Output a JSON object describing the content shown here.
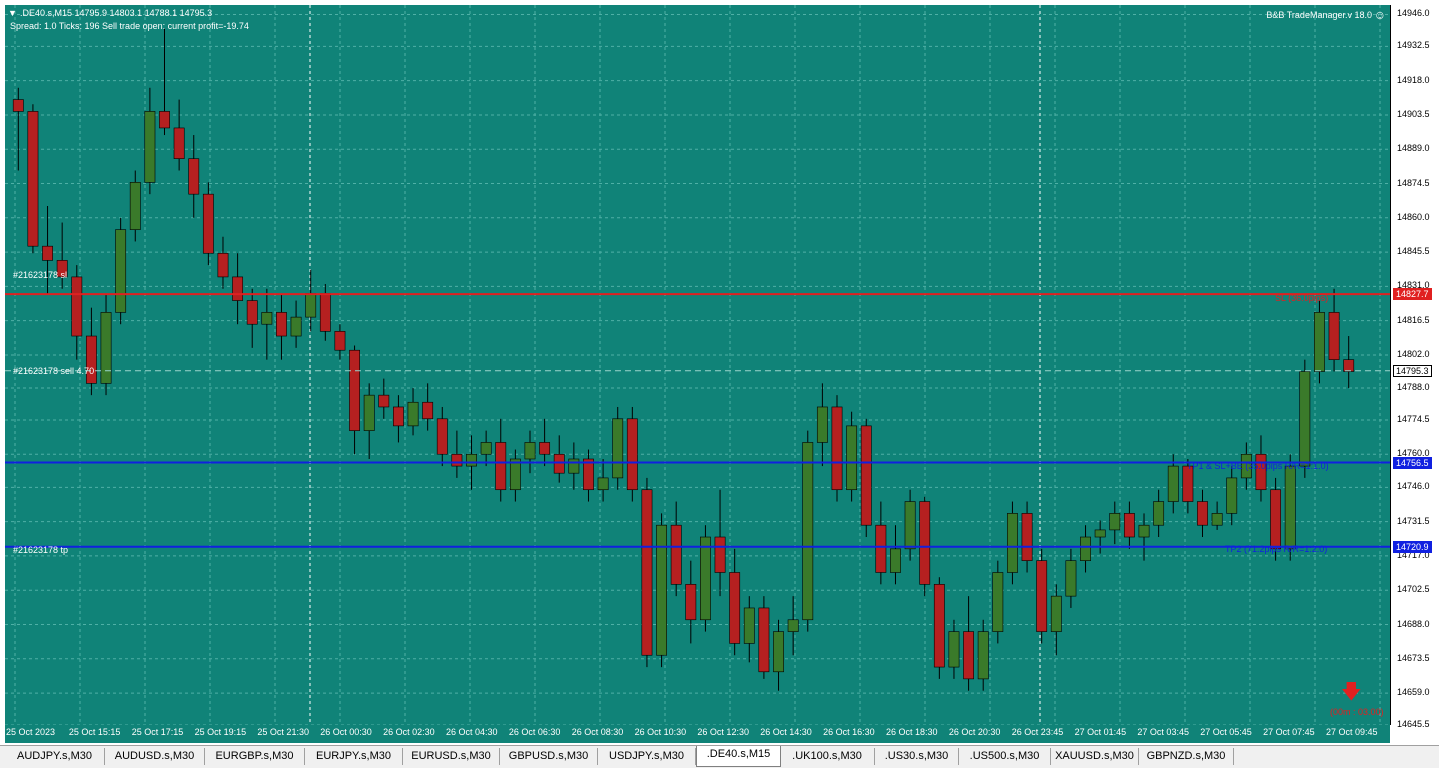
{
  "header": {
    "symbol_line": ".DE40.s,M15  14795.9 14803.1 14788.1 14795.3",
    "info_line": "Spread: 1.0  Ticks: 196  Sell trade open: current profit=-19.74",
    "manager": "B&B TradeManager.v 18.0",
    "smiley": "☺"
  },
  "order_labels": {
    "sl": "#21623178 sl",
    "sell": "#21623178 sell 4.70",
    "tp": "#21623178 tp"
  },
  "lines": {
    "sl_text": "SL (36.0pips)",
    "tp1_text": "TP1 & SL+BE (35.0pips R/R=1:1.0)",
    "tp2_text": "TP2 (71.2pips R/R=1:2.0)",
    "timer_text": "(00m : 03.00)"
  },
  "price_axis": {
    "ticks": [
      "14946.0",
      "14932.5",
      "14918.0",
      "14903.5",
      "14889.0",
      "14874.5",
      "14860.0",
      "14845.5",
      "14831.0",
      "14816.5",
      "14802.0",
      "14788.0",
      "14774.5",
      "14760.0",
      "14746.0",
      "14731.5",
      "14717.0",
      "14702.5",
      "14688.0",
      "14673.5",
      "14659.0",
      "14645.5"
    ],
    "sl_box": "14827.7",
    "current_box": "14795.3",
    "tp1_box": "14756.5",
    "tp2_box": "14720.9"
  },
  "time_axis": [
    "25 Oct 2023",
    "25 Oct 15:15",
    "25 Oct 17:15",
    "25 Oct 19:15",
    "25 Oct 21:30",
    "26 Oct 00:30",
    "26 Oct 02:30",
    "26 Oct 04:30",
    "26 Oct 06:30",
    "26 Oct 08:30",
    "26 Oct 10:30",
    "26 Oct 12:30",
    "26 Oct 14:30",
    "26 Oct 16:30",
    "26 Oct 18:30",
    "26 Oct 20:30",
    "26 Oct 23:45",
    "27 Oct 01:45",
    "27 Oct 03:45",
    "27 Oct 05:45",
    "27 Oct 07:45",
    "27 Oct 09:45"
  ],
  "tabs": [
    "AUDJPY.s,M30",
    "AUDUSD.s,M30",
    "EURGBP.s,M30",
    "EURJPY.s,M30",
    "EURUSD.s,M30",
    "GBPUSD.s,M30",
    "USDJPY.s,M30",
    ".DE40.s,M15",
    ".UK100.s,M30",
    ".US30.s,M30",
    ".US500.s,M30",
    "XAUUSD.s,M30",
    "GBPNZD.s,M30"
  ],
  "active_tab": ".DE40.s,M15",
  "colors": {
    "background": "#108378",
    "bull": "#3a7a2a",
    "bear": "#b52020",
    "sl_line": "#e02020",
    "tp_line": "#1020e0",
    "grid": "#4fb0a6",
    "highlight": "#ffb6c8"
  },
  "chart_data": {
    "type": "candlestick",
    "symbol": ".DE40.s",
    "timeframe": "M15",
    "ylim": [
      14645.5,
      14950
    ],
    "levels": {
      "sl": 14827.7,
      "entry": 14795.3,
      "tp1": 14756.5,
      "tp2": 14720.9
    },
    "candles": [
      [
        14910,
        14915,
        14880,
        14905
      ],
      [
        14905,
        14908,
        14845,
        14848
      ],
      [
        14848,
        14865,
        14828,
        14842
      ],
      [
        14842,
        14858,
        14830,
        14835
      ],
      [
        14835,
        14840,
        14800,
        14810
      ],
      [
        14810,
        14822,
        14785,
        14790
      ],
      [
        14790,
        14828,
        14785,
        14820
      ],
      [
        14820,
        14860,
        14815,
        14855
      ],
      [
        14855,
        14880,
        14850,
        14875
      ],
      [
        14875,
        14915,
        14870,
        14905
      ],
      [
        14905,
        14940,
        14895,
        14898
      ],
      [
        14898,
        14910,
        14880,
        14885
      ],
      [
        14885,
        14895,
        14860,
        14870
      ],
      [
        14870,
        14875,
        14840,
        14845
      ],
      [
        14845,
        14852,
        14830,
        14835
      ],
      [
        14835,
        14845,
        14815,
        14825
      ],
      [
        14825,
        14830,
        14805,
        14815
      ],
      [
        14815,
        14830,
        14800,
        14820
      ],
      [
        14820,
        14828,
        14800,
        14810
      ],
      [
        14810,
        14825,
        14805,
        14818
      ],
      [
        14818,
        14838,
        14812,
        14828
      ],
      [
        14828,
        14832,
        14808,
        14812
      ],
      [
        14812,
        14815,
        14800,
        14804
      ],
      [
        14804,
        14806,
        14760,
        14770
      ],
      [
        14770,
        14790,
        14758,
        14785
      ],
      [
        14785,
        14792,
        14775,
        14780
      ],
      [
        14780,
        14785,
        14765,
        14772
      ],
      [
        14772,
        14788,
        14768,
        14782
      ],
      [
        14782,
        14790,
        14770,
        14775
      ],
      [
        14775,
        14780,
        14755,
        14760
      ],
      [
        14760,
        14770,
        14750,
        14755
      ],
      [
        14755,
        14768,
        14745,
        14760
      ],
      [
        14760,
        14770,
        14755,
        14765
      ],
      [
        14765,
        14775,
        14740,
        14745
      ],
      [
        14745,
        14762,
        14740,
        14758
      ],
      [
        14758,
        14770,
        14752,
        14765
      ],
      [
        14765,
        14775,
        14755,
        14760
      ],
      [
        14760,
        14768,
        14748,
        14752
      ],
      [
        14752,
        14765,
        14745,
        14758
      ],
      [
        14758,
        14762,
        14740,
        14745
      ],
      [
        14745,
        14758,
        14740,
        14750
      ],
      [
        14750,
        14780,
        14745,
        14775
      ],
      [
        14775,
        14780,
        14740,
        14745
      ],
      [
        14745,
        14750,
        14670,
        14675
      ],
      [
        14675,
        14735,
        14670,
        14730
      ],
      [
        14730,
        14740,
        14700,
        14705
      ],
      [
        14705,
        14715,
        14680,
        14690
      ],
      [
        14690,
        14730,
        14685,
        14725
      ],
      [
        14725,
        14745,
        14700,
        14710
      ],
      [
        14710,
        14720,
        14675,
        14680
      ],
      [
        14680,
        14700,
        14672,
        14695
      ],
      [
        14695,
        14700,
        14665,
        14668
      ],
      [
        14668,
        14690,
        14660,
        14685
      ],
      [
        14685,
        14700,
        14675,
        14690
      ],
      [
        14690,
        14770,
        14685,
        14765
      ],
      [
        14765,
        14790,
        14755,
        14780
      ],
      [
        14780,
        14785,
        14740,
        14745
      ],
      [
        14745,
        14778,
        14740,
        14772
      ],
      [
        14772,
        14775,
        14725,
        14730
      ],
      [
        14730,
        14740,
        14705,
        14710
      ],
      [
        14710,
        14730,
        14705,
        14720
      ],
      [
        14720,
        14745,
        14715,
        14740
      ],
      [
        14740,
        14742,
        14700,
        14705
      ],
      [
        14705,
        14708,
        14665,
        14670
      ],
      [
        14670,
        14690,
        14665,
        14685
      ],
      [
        14685,
        14700,
        14660,
        14665
      ],
      [
        14665,
        14690,
        14660,
        14685
      ],
      [
        14685,
        14715,
        14680,
        14710
      ],
      [
        14710,
        14740,
        14705,
        14735
      ],
      [
        14735,
        14740,
        14710,
        14715
      ],
      [
        14715,
        14720,
        14680,
        14685
      ],
      [
        14685,
        14705,
        14675,
        14700
      ],
      [
        14700,
        14720,
        14695,
        14715
      ],
      [
        14715,
        14730,
        14710,
        14725
      ],
      [
        14725,
        14732,
        14718,
        14728
      ],
      [
        14728,
        14740,
        14722,
        14735
      ],
      [
        14735,
        14740,
        14720,
        14725
      ],
      [
        14725,
        14735,
        14715,
        14730
      ],
      [
        14730,
        14745,
        14725,
        14740
      ],
      [
        14740,
        14760,
        14735,
        14755
      ],
      [
        14755,
        14758,
        14735,
        14740
      ],
      [
        14740,
        14745,
        14725,
        14730
      ],
      [
        14730,
        14740,
        14728,
        14735
      ],
      [
        14735,
        14755,
        14730,
        14750
      ],
      [
        14750,
        14765,
        14745,
        14760
      ],
      [
        14760,
        14768,
        14740,
        14745
      ],
      [
        14745,
        14750,
        14715,
        14720
      ],
      [
        14720,
        14760,
        14715,
        14755
      ],
      [
        14755,
        14800,
        14750,
        14795
      ],
      [
        14795,
        14825,
        14790,
        14820
      ],
      [
        14820,
        14830,
        14795,
        14800
      ],
      [
        14800,
        14810,
        14788,
        14795
      ]
    ]
  }
}
